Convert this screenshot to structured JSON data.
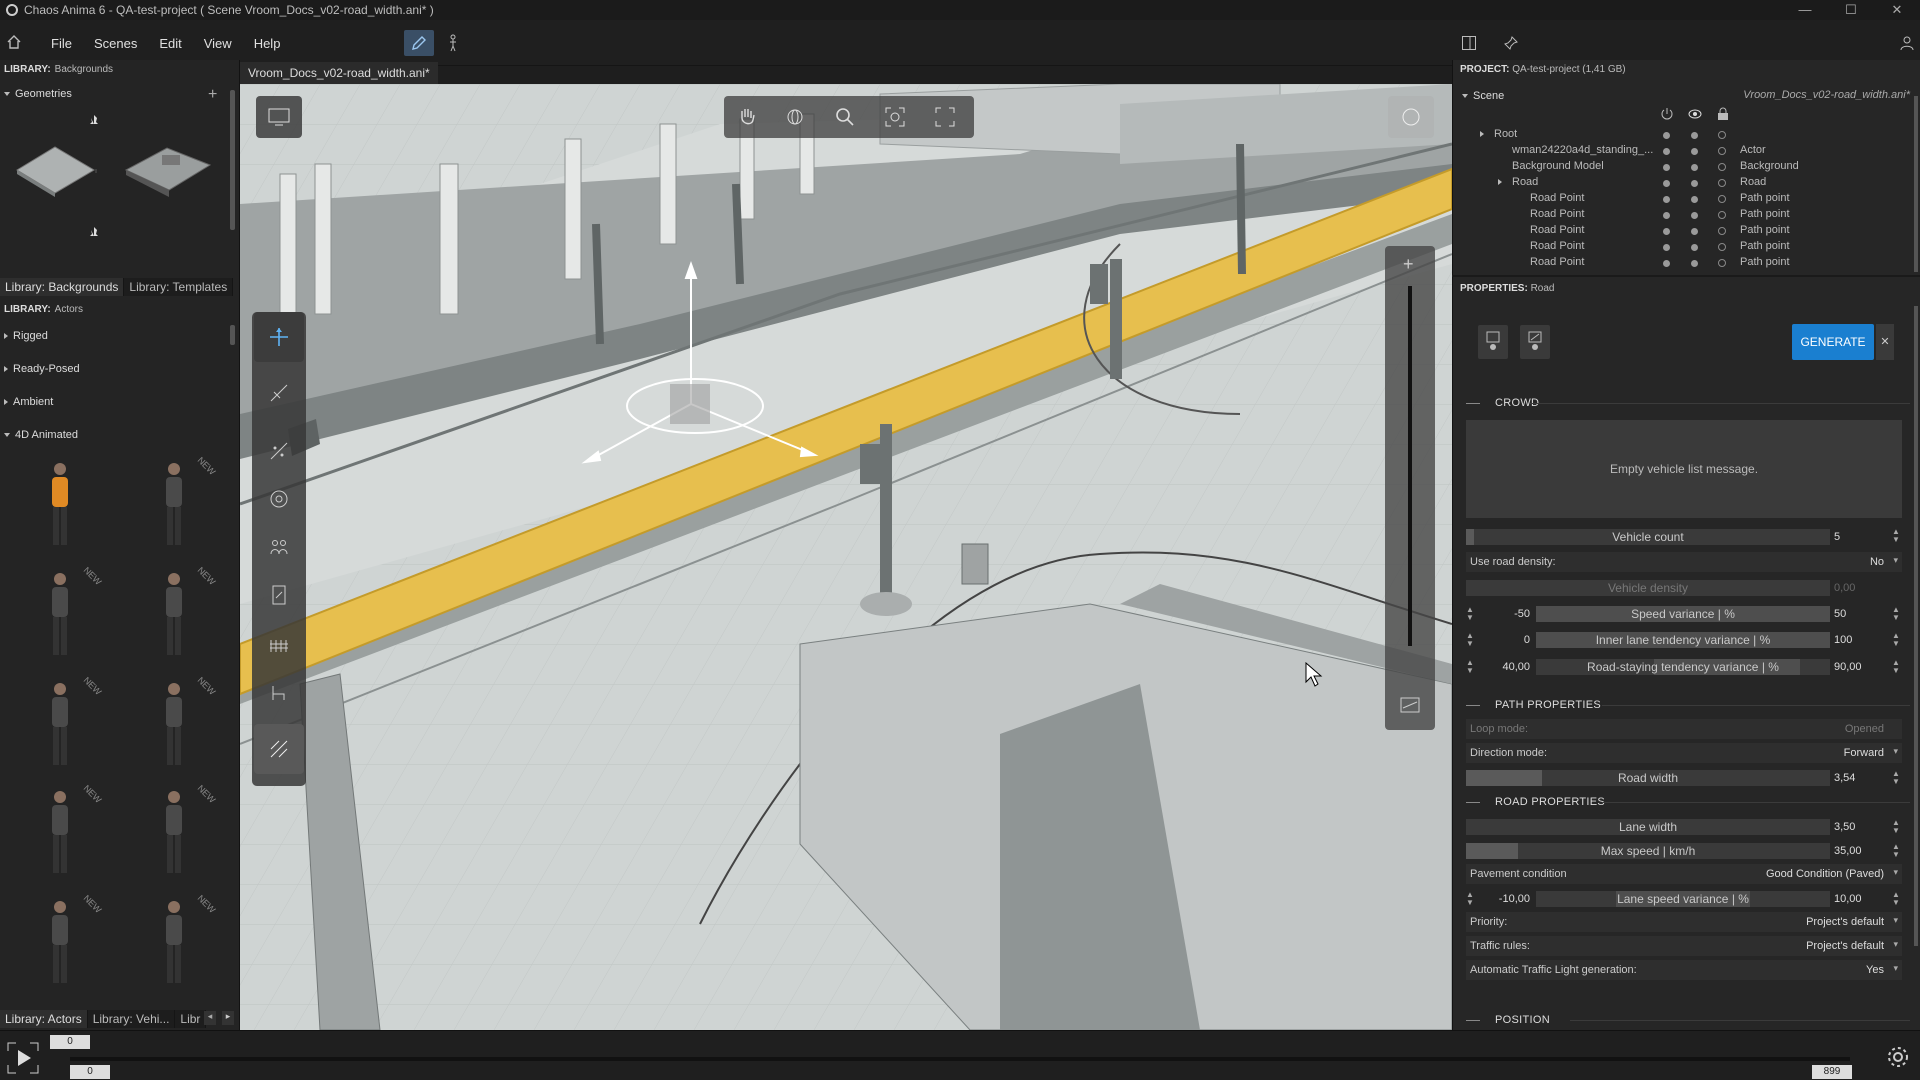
{
  "window": {
    "title": "Chaos Anima 6 -   QA-test-project ( Scene Vroom_Docs_v02-road_width.ani* )",
    "minimize": "—",
    "maximize": "☐",
    "close": "✕"
  },
  "menu": {
    "items": [
      "File",
      "Scenes",
      "Edit",
      "View",
      "Help"
    ]
  },
  "left": {
    "lib_bg_label": "LIBRARY:",
    "lib_bg_name": "Backgrounds",
    "geometries": "Geometries",
    "tabs_top": [
      "Library: Backgrounds",
      "Library: Templates"
    ],
    "lib_actors_label": "LIBRARY:",
    "lib_actors_name": "Actors",
    "categories": [
      "Rigged",
      "Ready-Posed",
      "Ambient",
      "4D Animated"
    ],
    "new_badge": "NEW",
    "tabs_bottom": [
      "Library: Actors",
      "Library: Vehi...",
      "Libr"
    ]
  },
  "viewport": {
    "tab": "Vroom_Docs_v02-road_width.ani*"
  },
  "project": {
    "label": "PROJECT:",
    "name": "QA-test-project (1,41 GB)"
  },
  "scene": {
    "title": "Scene",
    "file": "Vroom_Docs_v02-road_width.ani*",
    "rows": [
      {
        "name": "Root",
        "type": ""
      },
      {
        "name": "wman24220a4d_standing_...",
        "type": "Actor"
      },
      {
        "name": "Background Model",
        "type": "Background"
      },
      {
        "name": "Road",
        "type": "Road"
      },
      {
        "name": "Road Point",
        "type": "Path point"
      },
      {
        "name": "Road Point",
        "type": "Path point"
      },
      {
        "name": "Road Point",
        "type": "Path point"
      },
      {
        "name": "Road Point",
        "type": "Path point"
      },
      {
        "name": "Road Point",
        "type": "Path point"
      }
    ]
  },
  "properties": {
    "label": "PROPERTIES:",
    "target": "Road",
    "generate": "GENERATE",
    "close": "✕",
    "crowd_title": "CROWD",
    "empty_msg": "Empty vehicle list message.",
    "vehicle_count": {
      "label": "Vehicle count",
      "value": "5"
    },
    "use_road_density": {
      "label": "Use road density:",
      "value": "No"
    },
    "vehicle_density": {
      "label": "Vehicle density",
      "value": "0,00"
    },
    "speed_variance": {
      "label": "Speed variance | %",
      "min": "-50",
      "max": "50"
    },
    "inner_lane": {
      "label": "Inner lane tendency variance | %",
      "min": "0",
      "max": "100"
    },
    "road_staying": {
      "label": "Road-staying tendency variance | %",
      "min": "40,00",
      "max": "90,00"
    },
    "path_title": "PATH PROPERTIES",
    "loop_mode": {
      "label": "Loop mode:",
      "value": "Opened"
    },
    "direction_mode": {
      "label": "Direction mode:",
      "value": "Forward"
    },
    "road_width": {
      "label": "Road width",
      "value": "3,54"
    },
    "road_title": "ROAD PROPERTIES",
    "lane_width": {
      "label": "Lane width",
      "value": "3,50"
    },
    "max_speed": {
      "label": "Max speed | km/h",
      "value": "35,00"
    },
    "pavement": {
      "label": "Pavement condition",
      "value": "Good Condition (Paved)"
    },
    "lane_speed": {
      "label": "Lane speed variance | %",
      "min": "-10,00",
      "max": "10,00"
    },
    "priority": {
      "label": "Priority:",
      "value": "Project's default"
    },
    "traffic": {
      "label": "Traffic rules:",
      "value": "Project's default"
    },
    "auto_tl": {
      "label": "Automatic Traffic Light generation:",
      "value": "Yes"
    },
    "position_title": "POSITION"
  },
  "timeline": {
    "start": "0",
    "current": "0",
    "end": "899"
  },
  "colors": {
    "accent": "#1a7fd0",
    "road": "#e7bf4e"
  }
}
